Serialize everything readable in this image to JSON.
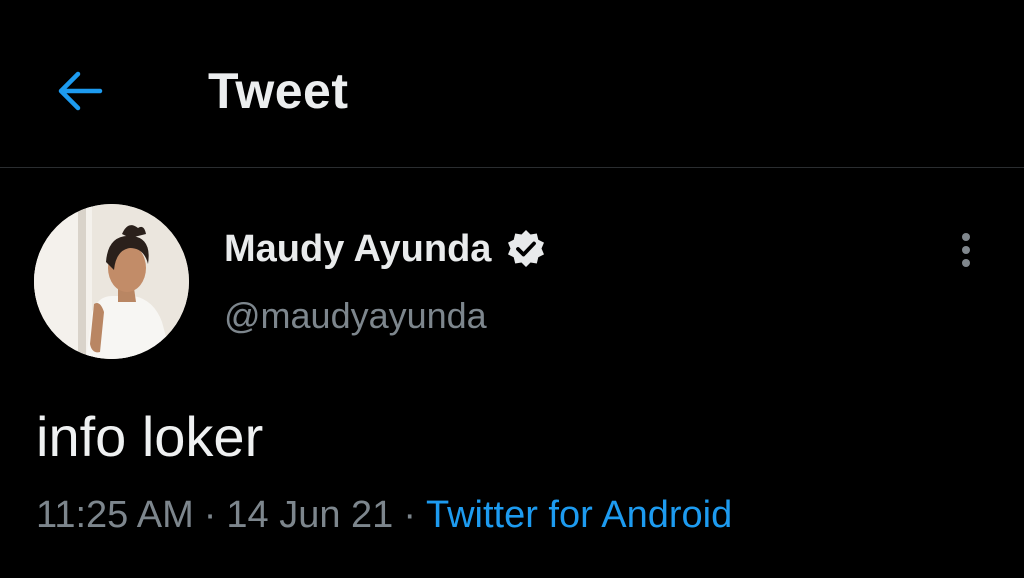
{
  "header": {
    "title": "Tweet",
    "back_icon": "arrow-left-icon"
  },
  "tweet": {
    "author": {
      "display_name": "Maudy Ayunda",
      "handle": "@maudyayunda",
      "verified": true,
      "avatar": "profile-photo"
    },
    "text": "info loker",
    "time": "11:25 AM",
    "separator": "·",
    "date": "14 Jun 21",
    "source": "Twitter for Android",
    "more_icon": "more-vertical-icon"
  },
  "colors": {
    "background": "#000000",
    "accent": "#1d9bf0",
    "primary_text": "#e7e9ea",
    "secondary_text": "#7d868d",
    "divider": "#2a2d30"
  }
}
